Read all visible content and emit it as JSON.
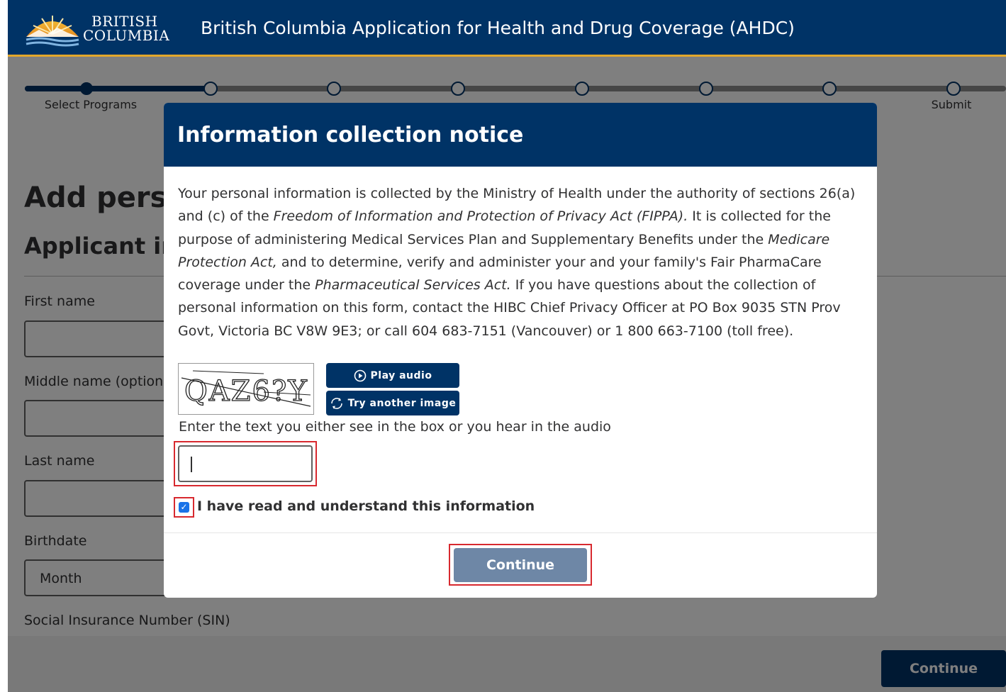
{
  "header": {
    "logo_line1": "BRITISH",
    "logo_line2": "COLUMBIA",
    "title": "British Columbia Application for Health and Drug Coverage (AHDC)"
  },
  "stepper": {
    "first_label": "Select Programs",
    "last_label": "Submit"
  },
  "page": {
    "title": "Add perso",
    "subtitle": "Applicant inf",
    "first_name_label": "First name",
    "middle_name_label": "Middle name (option",
    "last_name_label": "Last name",
    "birthdate_label": "Birthdate",
    "month_value": "Month",
    "sin_label": "Social Insurance Number (SIN)",
    "continue_label": "Continue"
  },
  "modal": {
    "title": "Information collection notice",
    "notice_parts": {
      "p1": "Your personal information is collected by the Ministry of Health under the authority of sections 26(a) and (c) of the ",
      "act1": "Freedom of Information and Protection of Privacy Act (FIPPA).",
      "p2": " It is collected for the purpose of administering Medical Services Plan and Supplementary Benefits under the ",
      "act2": "Medicare Protection Act,",
      "p3": " and to determine, verify and administer your and your family's Fair PharmaCare coverage under the ",
      "act3": "Pharmaceutical Services Act.",
      "p4": " If you have questions about the collection of personal information on this form, contact the HIBC Chief Privacy Officer at PO Box 9035 STN Prov Govt, Victoria BC V8W 9E3; or call 604 683-7151 (Vancouver) or 1 800 663-7100 (toll free)."
    },
    "captcha": {
      "image_text": "QAZ6?Y",
      "play_audio_label": "Play audio",
      "try_another_label": "Try another image",
      "hint": "Enter the text you either see in the box or you hear in the audio",
      "input_value": ""
    },
    "checkbox_label": "I have read and understand this information",
    "checkbox_checked": true,
    "continue_label": "Continue"
  },
  "colors": {
    "brand_navy": "#003366",
    "accent_gold": "#e3a82b",
    "highlight_red": "#d8292f",
    "disabled_button": "#6e87a6"
  }
}
